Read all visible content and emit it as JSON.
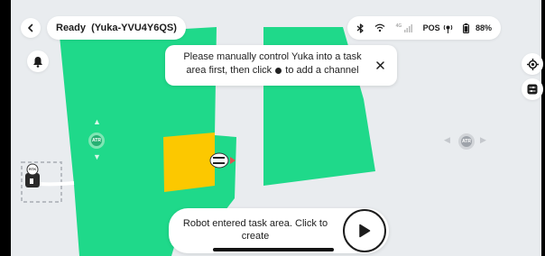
{
  "header": {
    "status_title": "Ready  (Yuka-YVU4Y6QS)",
    "back_icon": "chevron-left-icon"
  },
  "status_bar": {
    "bluetooth_icon": "bluetooth-icon",
    "wifi_icon": "wifi-icon",
    "cellular_label": "4G",
    "pos_label": "POS",
    "battery_percent": "88%"
  },
  "toast": {
    "message_part1": "Please manually control Yuka into a task area first, then click",
    "message_part2": "to add a channel",
    "close_icon": "close-icon"
  },
  "bottom_prompt": {
    "message": "Robot entered task area. Click to create",
    "play_icon": "play-icon"
  },
  "map": {
    "joystick_left_label": "ATR",
    "joystick_right_label": "ATR",
    "station_label": "RTK",
    "colors": {
      "lawn": "#1fd98a",
      "task_area": "#fcc800",
      "background": "#e9ecef"
    }
  },
  "right_toolbar": {
    "locate_icon": "crosshair-icon",
    "settings_icon": "sliders-icon"
  },
  "left_toolbar": {
    "alert_icon": "bell-icon"
  }
}
